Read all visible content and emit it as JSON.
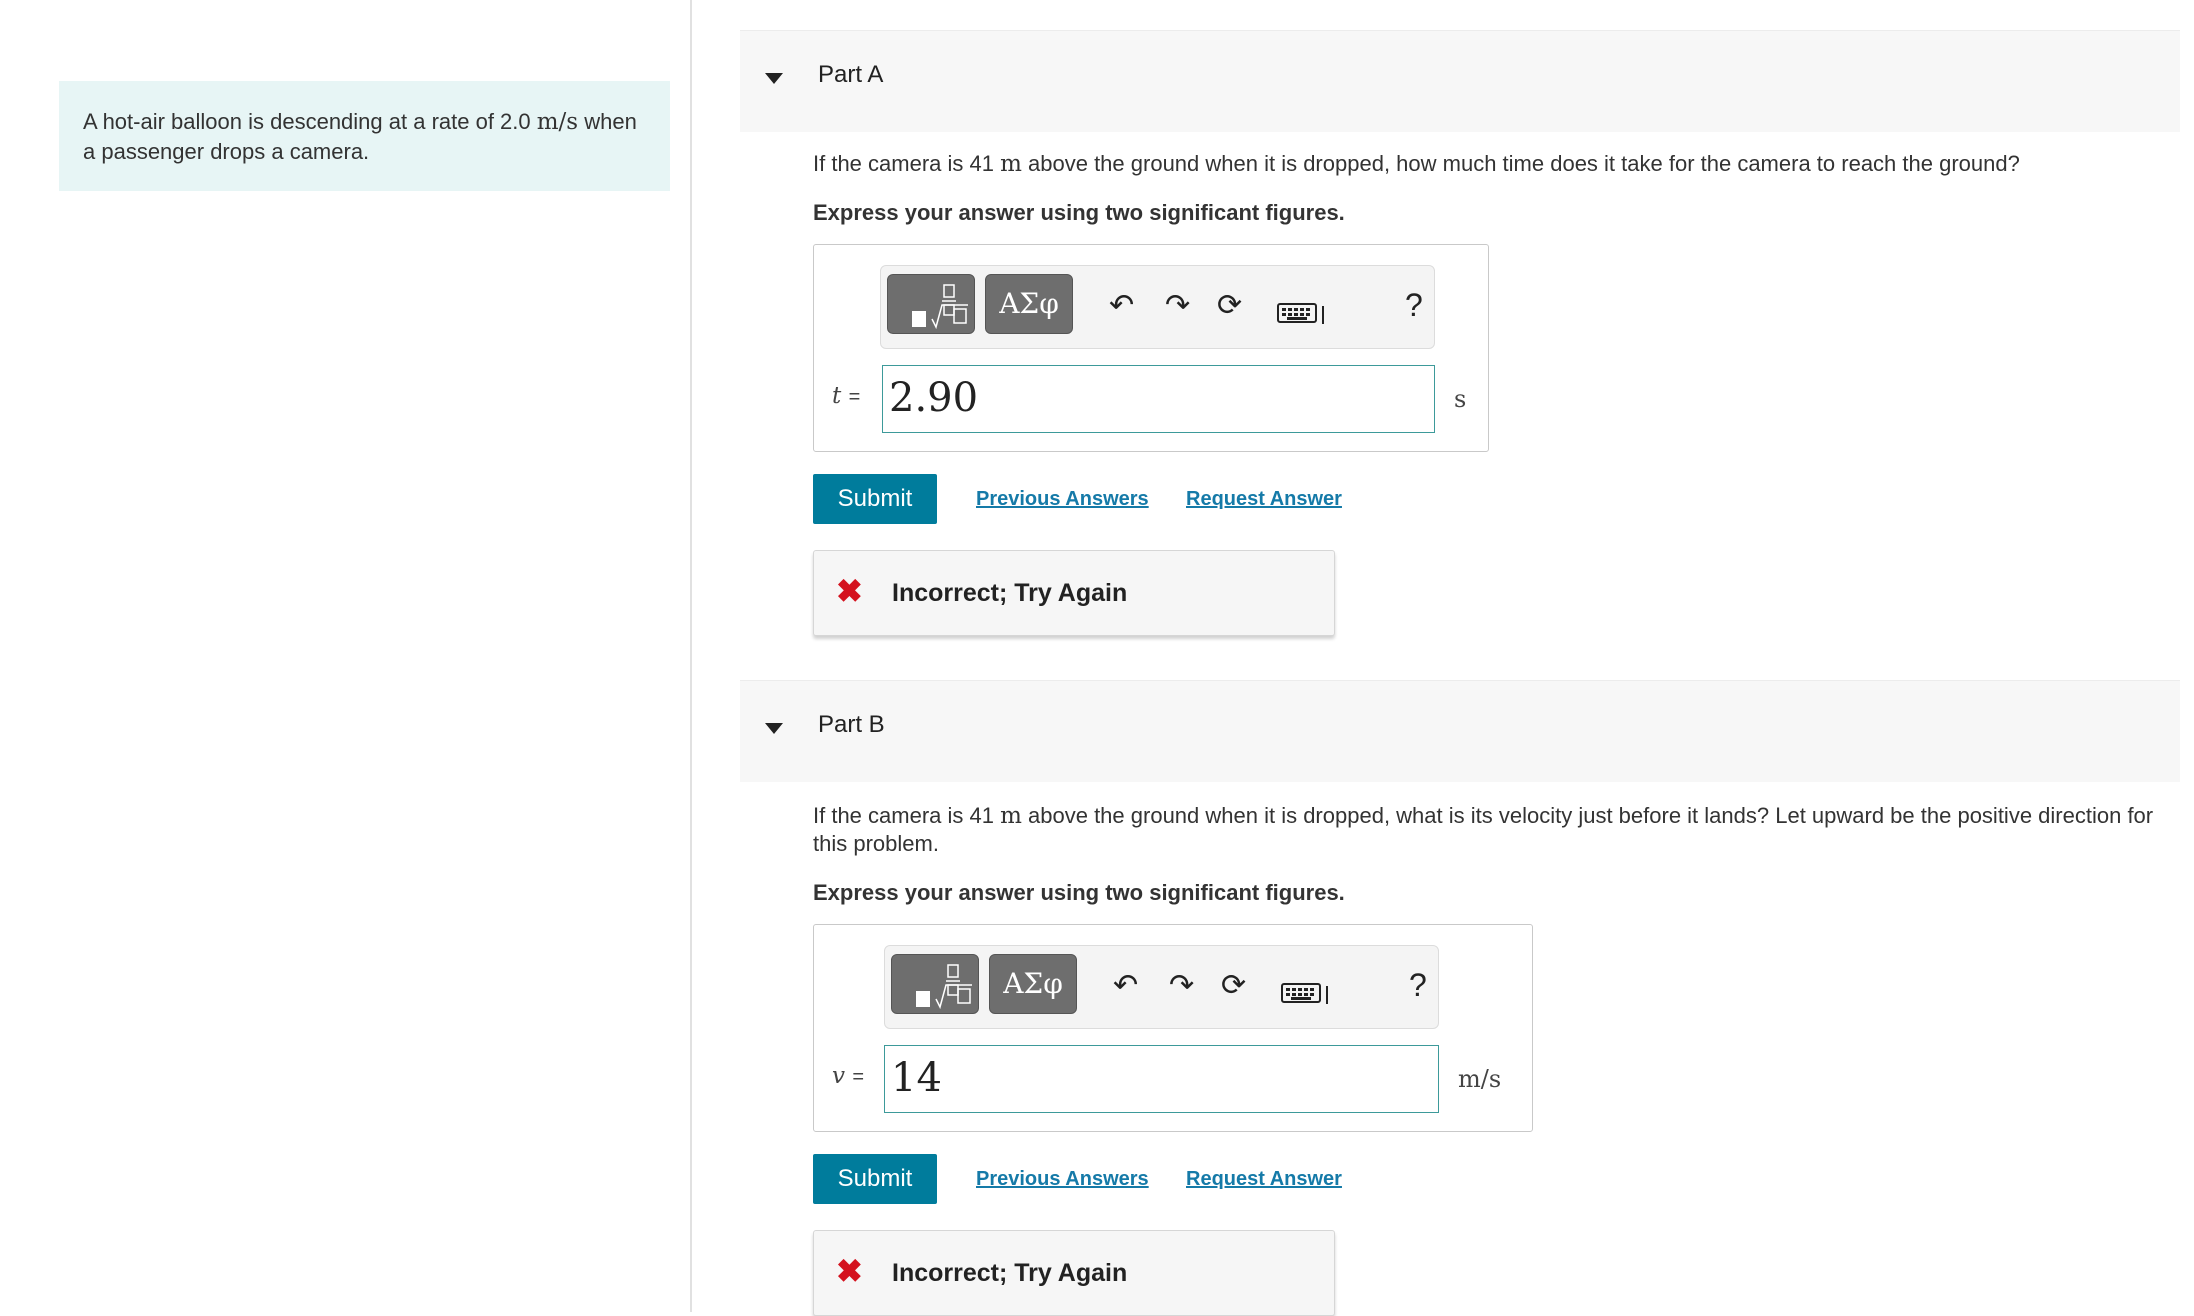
{
  "problem": {
    "statement_before": "A hot-air balloon is descending at a rate of 2.0 ",
    "rate_unit": "m/s",
    "statement_after": " when a passenger drops a camera."
  },
  "toolbar": {
    "greek_label": "ΑΣφ",
    "help_label": "?",
    "icons": [
      "templates-icon",
      "greek-symbols-icon",
      "undo-icon",
      "redo-icon",
      "reset-icon",
      "keyboard-icon",
      "help-icon"
    ]
  },
  "parts": [
    {
      "title": "Part A",
      "question_before": "If the camera is 41 ",
      "question_unit": "m",
      "question_after": " above the ground when it is dropped, how much time does it take for the camera to reach the ground?",
      "instruction": "Express your answer using two significant figures.",
      "variable": "t",
      "equals": "=",
      "answer_value": "2.90",
      "unit": "s",
      "submit_label": "Submit",
      "previous_answers_label": "Previous Answers",
      "request_answer_label": "Request Answer",
      "feedback": "Incorrect; Try Again"
    },
    {
      "title": "Part B",
      "question_before": "If the camera is 41 ",
      "question_unit": "m",
      "question_after": " above the ground when it is dropped, what is its velocity just before it lands? Let upward be the positive direction for this problem.",
      "instruction": "Express your answer using two significant figures.",
      "variable": "v",
      "equals": "=",
      "answer_value": "14",
      "unit": "m/s",
      "submit_label": "Submit",
      "previous_answers_label": "Previous Answers",
      "request_answer_label": "Request Answer",
      "feedback": "Incorrect; Try Again"
    }
  ],
  "colors": {
    "submit_bg": "#007c9c",
    "link": "#157aa8",
    "error_icon": "#d4121e",
    "problem_bg": "#e7f5f5",
    "input_border": "#3d9a9a"
  }
}
